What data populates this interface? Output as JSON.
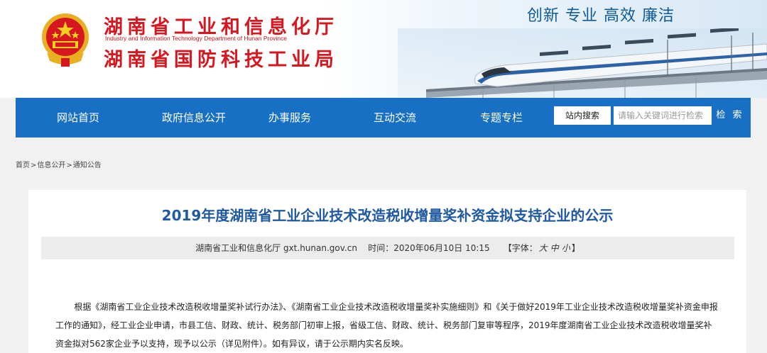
{
  "header": {
    "title_line1": "湖南省工业和信息化厅",
    "title_en": "Industry and Information Technology Department of Hunan Province",
    "title_line2": "湖南省国防科技工业局",
    "slogan": "创新 专业 高效 廉洁"
  },
  "nav": {
    "items": [
      {
        "label": "网站首页"
      },
      {
        "label": "政府信息公开"
      },
      {
        "label": "办事服务"
      },
      {
        "label": "互动交流"
      },
      {
        "label": "专题专栏"
      }
    ],
    "search_label": "站内搜索",
    "search_placeholder": "请输入关键词进行检索",
    "search_button": "检 索"
  },
  "breadcrumb": {
    "items": [
      "首页",
      "信息公开",
      "通知公告"
    ],
    "separator": ">"
  },
  "article": {
    "title": "2019年度湖南省工业企业技术改造税收增量奖补资金拟支持企业的公示",
    "meta_source": "湖南省工业和信息化厅 gxt.hunan.gov.cn",
    "meta_time": "时间：2020年06月10日 10:15",
    "meta_font_prefix": "【字体：",
    "meta_font_large": "大",
    "meta_font_medium": "中",
    "meta_font_small": "小",
    "meta_font_suffix": "】",
    "body": "根据《湖南省工业企业技术改造税收增量奖补试行办法》、《湖南省工业企业技术改造税收增量奖补实施细则》和《关于做好2019年工业企业技术改造税收增量奖补资金申报工作的通知》，经工业企业申请，市县工信、财政、统计、税务部门初审上报，省级工信、财政、统计、税务部门复审等程序，2019年度湖南省工业企业技术改造税收增量奖补资金拟对562家企业予以支持，现予以公示（详见附件）。如有异议，请于公示期内实名反映。"
  },
  "colors": {
    "nav_bg": "#1770c4",
    "title_red": "#d7171f",
    "article_title": "#1f5aa0",
    "slogan": "#0f5a9a"
  }
}
